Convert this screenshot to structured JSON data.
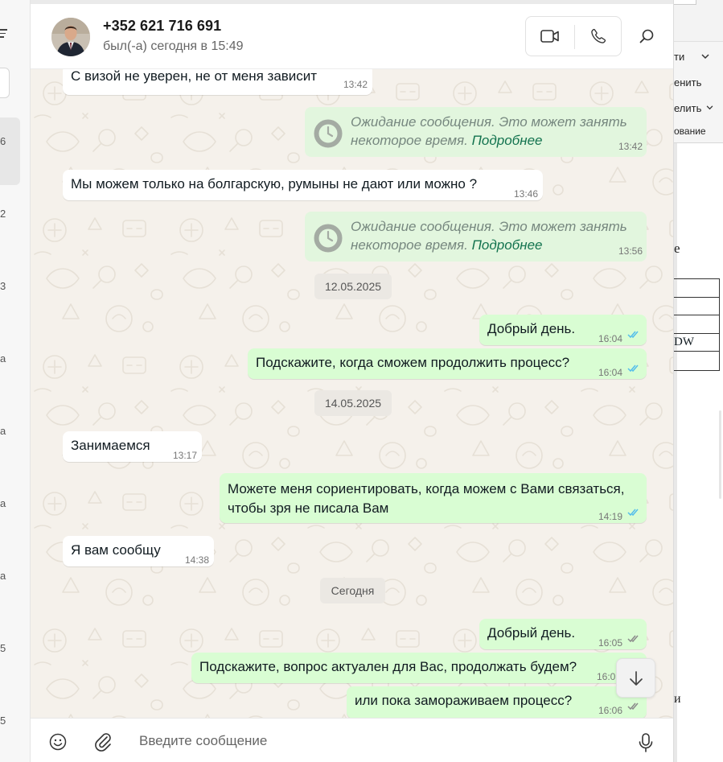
{
  "left_panel": {
    "counts": [
      "6",
      "2",
      "3",
      "а",
      "а",
      "а",
      "а",
      "5",
      "5"
    ]
  },
  "right_window": {
    "ribbon": [
      "ти",
      "енить",
      "елить",
      "ование"
    ],
    "doc_heading": "е",
    "table_cells": [
      "",
      "",
      "",
      "DW",
      ""
    ],
    "doc_letter": "и"
  },
  "header": {
    "contact_name": "+352 621 716 691",
    "status": "был(-а) сегодня в 15:49"
  },
  "messages": [
    {
      "dir": "in",
      "text": "С визой не уверен, не от меня зависит",
      "time": "13:42"
    },
    {
      "dir": "pending",
      "text_line1": "Ожидание сообщения. Это может занять",
      "text_line2": "некоторое время.",
      "link": "Подробнее",
      "time": "13:42"
    },
    {
      "dir": "in",
      "text": "Мы можем только на болгарскую, румыны не дают или можно ?",
      "time": "13:46"
    },
    {
      "dir": "pending",
      "text_line1": "Ожидание сообщения. Это может занять",
      "text_line2": "некоторое время.",
      "link": "Подробнее",
      "time": "13:56"
    },
    {
      "dir": "date",
      "text": "12.05.2025"
    },
    {
      "dir": "out",
      "text": "Добрый день.",
      "time": "16:04",
      "status": "read"
    },
    {
      "dir": "out",
      "text": "Подскажите, когда сможем продолжить процесс?",
      "time": "16:04",
      "status": "read"
    },
    {
      "dir": "date",
      "text": "14.05.2025"
    },
    {
      "dir": "in",
      "text": "Занимаемся",
      "time": "13:17"
    },
    {
      "dir": "out",
      "text": "Можете меня сориентировать, когда можем с Вами связаться,\nчтобы зря не писала Вам",
      "time": "14:19",
      "status": "read"
    },
    {
      "dir": "in",
      "text": "Я вам сообщу",
      "time": "14:38"
    },
    {
      "dir": "date",
      "text": "Сегодня"
    },
    {
      "dir": "out",
      "text": "Добрый день.",
      "time": "16:05",
      "status": "delivered"
    },
    {
      "dir": "out",
      "text": "Подскажите, вопрос актуален для Вас, продолжать будем?",
      "time": "16:0",
      "status": "delivered"
    },
    {
      "dir": "out",
      "text": "или пока замораживаем процесс?",
      "time": "16:06",
      "status": "delivered"
    }
  ],
  "composer": {
    "placeholder": "Введите сообщение"
  },
  "icons": {
    "video": "video-call-icon",
    "voice": "voice-call-icon",
    "search": "search-icon",
    "emoji": "emoji-icon",
    "attach": "paperclip-icon",
    "mic": "microphone-icon",
    "scroll": "arrow-down-icon",
    "pending": "clock-icon"
  },
  "colors": {
    "outgoing_bubble": "#d9fdd3",
    "incoming_bubble": "#ffffff",
    "chat_background": "#f5f1eb",
    "read_ticks": "#53bdeb",
    "link": "#13734f"
  }
}
